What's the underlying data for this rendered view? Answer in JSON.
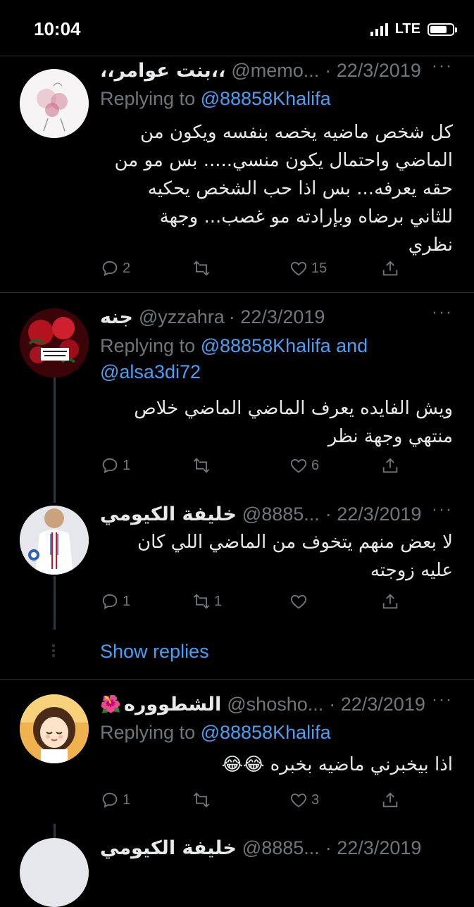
{
  "status_bar": {
    "time": "10:04",
    "network": "LTE",
    "battery_level": 0.75
  },
  "tweets": [
    {
      "name": "،،بنت عوامر،،",
      "handle": "@memo...",
      "date": "· 22/3/2019",
      "more": "···",
      "replying_prefix": "Replying to ",
      "replying_to": "@88858Khalifa",
      "lines": [
        "كل شخص ماضيه يخصه بنفسه ويكون من",
        "الماضي واحتمال يكون منسي..... بس مو من",
        "حقه يعرفه... بس اذا حب الشخص يحكيه",
        "للثاني برضاه وبإرادته مو غصب... وجهة",
        "نظري"
      ],
      "reply_count": "2",
      "retweet_count": "",
      "like_count": "15"
    },
    {
      "name": "جنه",
      "handle": "@yzzahra",
      "date": "· 22/3/2019",
      "more": "···",
      "replying_prefix": "Replying to ",
      "replying_to": "@88858Khalifa and",
      "replying_to_2": "@alsa3di72",
      "lines": [
        "ويش الفايده يعرف الماضي الماضي خلاص",
        "منتهي وجهة نظر"
      ],
      "reply_count": "1",
      "retweet_count": "",
      "like_count": "6"
    },
    {
      "name": "خليفة الكيومي",
      "handle": "@8885...",
      "date": "· 22/3/2019",
      "more": "···",
      "lines": [
        "لا بعض منهم يتخوف من الماضي اللي كان",
        "عليه زوجته"
      ],
      "reply_count": "1",
      "retweet_count": "1",
      "like_count": ""
    },
    {
      "name": "الشطووره",
      "name_emoji": "🌺",
      "handle": "@shosho...",
      "date": "· 22/3/2019",
      "more": "···",
      "replying_prefix": "Replying to ",
      "replying_to": "@88858Khalifa",
      "lines": [
        "اذا بيخبرني ماضيه بخبره 😂😂"
      ],
      "reply_count": "1",
      "retweet_count": "",
      "like_count": "3"
    }
  ],
  "show_replies_label": "Show replies",
  "partial_next": {
    "name": "خليفة الكيومي",
    "handle": "@8885...",
    "date": "· 22/3/2019"
  },
  "colors": {
    "background": "#000000",
    "link": "#4a9ff5",
    "muted": "#71767b",
    "divider": "#2f3336"
  }
}
